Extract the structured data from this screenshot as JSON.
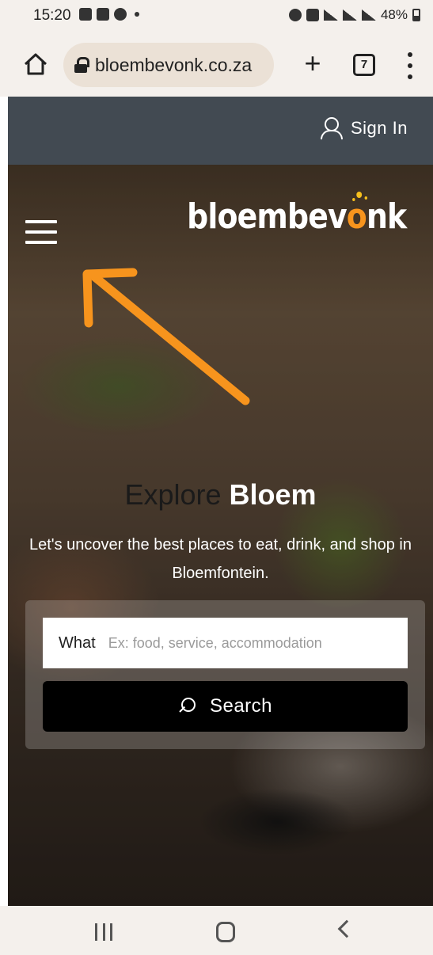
{
  "status_bar": {
    "time": "15:20",
    "battery": "48%"
  },
  "browser": {
    "url": "bloembevonk.co.za",
    "tab_count": "7",
    "new_tab_label": "+"
  },
  "header": {
    "sign_in": "Sign In"
  },
  "hero": {
    "logo_main": "bloembev",
    "logo_o": "o",
    "logo_end": "nk",
    "title_dark": "Explore",
    "title_light": "Bloem",
    "tagline": "Let's uncover the best places to eat, drink, and shop in Bloemfontein."
  },
  "search": {
    "what_label": "What",
    "what_placeholder": "Ex: food, service, accommodation",
    "button_label": "Search"
  },
  "colors": {
    "header_bg": "#424a52",
    "accent_arrow": "#f7941d",
    "logo_accent": "#f7941d",
    "search_button": "#000000"
  }
}
